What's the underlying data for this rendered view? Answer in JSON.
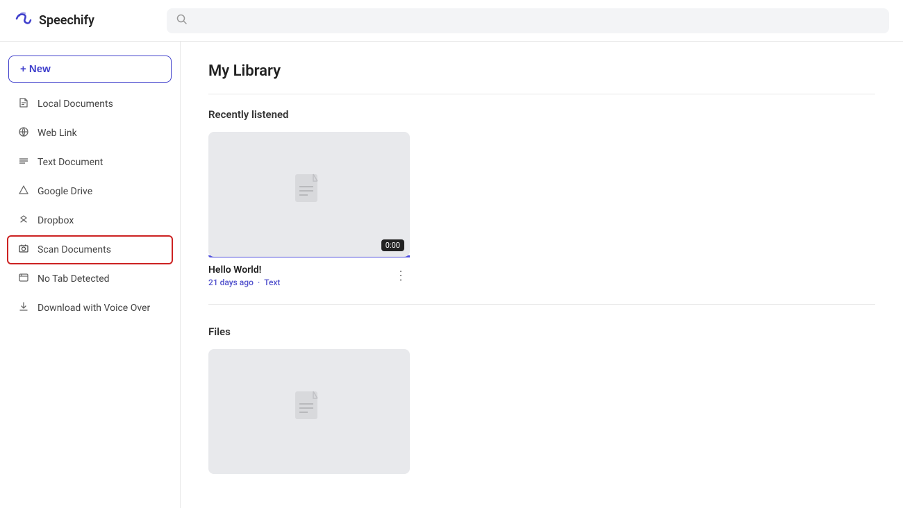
{
  "header": {
    "logo_text": "Speechify",
    "search_placeholder": ""
  },
  "sidebar": {
    "new_button_label": "+ New",
    "items": [
      {
        "id": "local-documents",
        "label": "Local Documents",
        "icon": "📄"
      },
      {
        "id": "web-link",
        "label": "Web Link",
        "icon": "☁"
      },
      {
        "id": "text-document",
        "label": "Text Document",
        "icon": "≡"
      },
      {
        "id": "google-drive",
        "label": "Google Drive",
        "icon": "△"
      },
      {
        "id": "dropbox",
        "label": "Dropbox",
        "icon": "❖"
      },
      {
        "id": "scan-documents",
        "label": "Scan Documents",
        "icon": "📷",
        "highlighted": true
      },
      {
        "id": "no-tab-detected",
        "label": "No Tab Detected",
        "icon": "🖥"
      },
      {
        "id": "download-voice-over",
        "label": "Download with Voice Over",
        "icon": "⬇"
      }
    ]
  },
  "content": {
    "page_title": "My Library",
    "recently_listened_label": "Recently listened",
    "files_label": "Files",
    "card": {
      "title": "Hello World!",
      "meta_time": "21 days ago",
      "meta_dot": "·",
      "meta_type": "Text",
      "timestamp": "0:00"
    }
  }
}
